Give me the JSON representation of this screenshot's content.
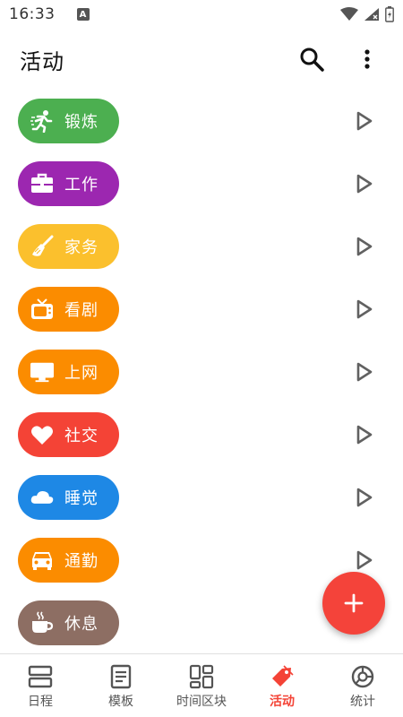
{
  "status_bar": {
    "time": "16:33",
    "notification_letter": "A"
  },
  "app_bar": {
    "title": "活动",
    "icons": [
      "search-icon",
      "more-vert-icon"
    ]
  },
  "activities": [
    {
      "label": "锻炼",
      "color": "#4caf50",
      "icon": "run-icon"
    },
    {
      "label": "工作",
      "color": "#9c27b0",
      "icon": "briefcase-icon"
    },
    {
      "label": "家务",
      "color": "#fbc02d",
      "icon": "broom-icon"
    },
    {
      "label": "看剧",
      "color": "#fb8c00",
      "icon": "tv-icon"
    },
    {
      "label": "上网",
      "color": "#fb8c00",
      "icon": "monitor-icon"
    },
    {
      "label": "社交",
      "color": "#f44336",
      "icon": "heart-icon"
    },
    {
      "label": "睡觉",
      "color": "#1e88e5",
      "icon": "cloud-icon"
    },
    {
      "label": "通勤",
      "color": "#fb8c00",
      "icon": "car-icon"
    },
    {
      "label": "休息",
      "color": "#8d6e63",
      "icon": "coffee-icon"
    }
  ],
  "fab": {
    "icon": "add-icon",
    "color": "#f4433a"
  },
  "bottom_nav": [
    {
      "label": "日程",
      "icon": "schedule-icon",
      "active": false
    },
    {
      "label": "模板",
      "icon": "template-icon",
      "active": false
    },
    {
      "label": "时间区块",
      "icon": "blocks-icon",
      "active": false
    },
    {
      "label": "活动",
      "icon": "tag-icon",
      "active": true
    },
    {
      "label": "统计",
      "icon": "chart-icon",
      "active": false
    }
  ],
  "colors": {
    "accent": "#f44336",
    "inactive": "#555555"
  }
}
